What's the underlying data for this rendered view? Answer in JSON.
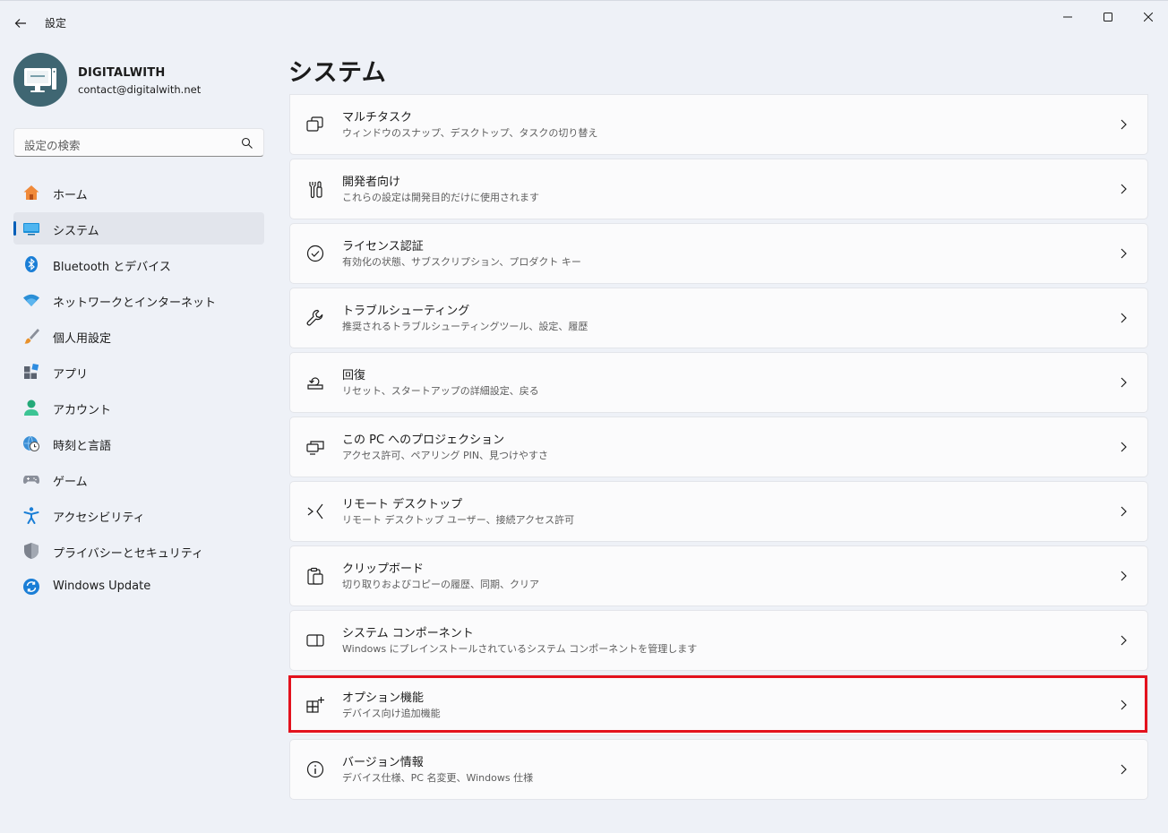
{
  "window": {
    "title": "設定"
  },
  "profile": {
    "name": "DIGITALWITH",
    "email": "contact@digitalwith.net"
  },
  "search": {
    "placeholder": "設定の検索"
  },
  "sidebar": {
    "items": [
      {
        "label": "ホーム",
        "icon": "home-icon"
      },
      {
        "label": "システム",
        "icon": "system-icon",
        "active": true
      },
      {
        "label": "Bluetooth とデバイス",
        "icon": "bluetooth-icon"
      },
      {
        "label": "ネットワークとインターネット",
        "icon": "wifi-icon"
      },
      {
        "label": "個人用設定",
        "icon": "brush-icon"
      },
      {
        "label": "アプリ",
        "icon": "apps-icon"
      },
      {
        "label": "アカウント",
        "icon": "account-icon"
      },
      {
        "label": "時刻と言語",
        "icon": "globe-clock-icon"
      },
      {
        "label": "ゲーム",
        "icon": "gamepad-icon"
      },
      {
        "label": "アクセシビリティ",
        "icon": "accessibility-icon"
      },
      {
        "label": "プライバシーとセキュリティ",
        "icon": "shield-icon"
      },
      {
        "label": "Windows Update",
        "icon": "update-icon"
      }
    ]
  },
  "main": {
    "title": "システム",
    "cards": [
      {
        "title": "マルチタスク",
        "desc": "ウィンドウのスナップ、デスクトップ、タスクの切り替え",
        "icon": "multitask-icon"
      },
      {
        "title": "開発者向け",
        "desc": "これらの設定は開発目的だけに使用されます",
        "icon": "developer-tools-icon"
      },
      {
        "title": "ライセンス認証",
        "desc": "有効化の状態、サブスクリプション、プロダクト キー",
        "icon": "check-circle-icon"
      },
      {
        "title": "トラブルシューティング",
        "desc": "推奨されるトラブルシューティングツール、設定、履歴",
        "icon": "wrench-icon"
      },
      {
        "title": "回復",
        "desc": "リセット、スタートアップの詳細設定、戻る",
        "icon": "recovery-icon"
      },
      {
        "title": "この PC へのプロジェクション",
        "desc": "アクセス許可、ペアリング PIN、見つけやすさ",
        "icon": "projection-icon"
      },
      {
        "title": "リモート デスクトップ",
        "desc": "リモート デスクトップ ユーザー、接続アクセス許可",
        "icon": "remote-desktop-icon"
      },
      {
        "title": "クリップボード",
        "desc": "切り取りおよびコピーの履歴、同期、クリア",
        "icon": "clipboard-icon"
      },
      {
        "title": "システム コンポーネント",
        "desc": "Windows にプレインストールされているシステム コンポーネントを管理します",
        "icon": "components-icon"
      },
      {
        "title": "オプション機能",
        "desc": "デバイス向け追加機能",
        "icon": "optional-features-icon",
        "highlighted": true
      },
      {
        "title": "バージョン情報",
        "desc": "デバイス仕様、PC 名変更、Windows 仕様",
        "icon": "info-icon"
      }
    ]
  },
  "colors": {
    "accent": "#005fb8",
    "highlight": "#e3121e",
    "background": "#eef1f7",
    "card": "#fbfbfc"
  }
}
